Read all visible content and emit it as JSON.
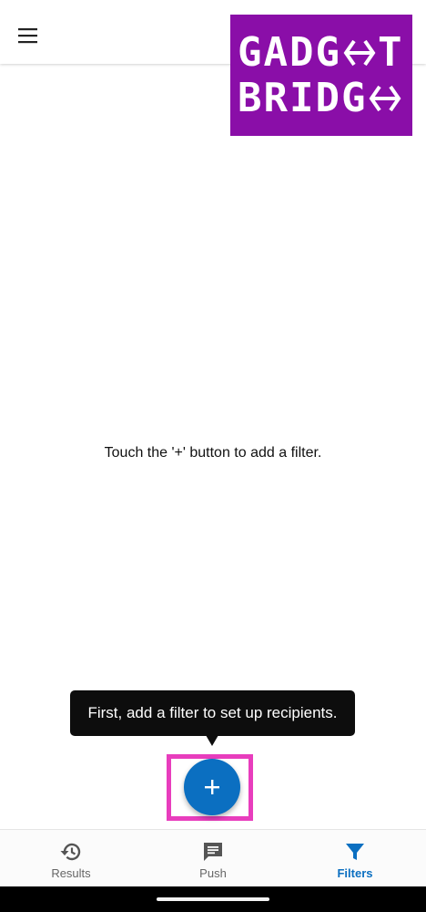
{
  "watermark": {
    "line1": "GADG",
    "line2": "BRIDG",
    "background": "#8a0ea8"
  },
  "header": {
    "menu_icon": "hamburger-menu-icon"
  },
  "main": {
    "empty_message": "Touch the '+' button to add a filter."
  },
  "tooltip": {
    "text": "First, add a filter to set up recipients."
  },
  "fab": {
    "icon": "plus-icon",
    "color": "#0b6fc1"
  },
  "highlight_color": "#e83dbd",
  "bottom_nav": {
    "items": [
      {
        "label": "Results",
        "icon": "history-icon",
        "active": false
      },
      {
        "label": "Push",
        "icon": "message-icon",
        "active": false
      },
      {
        "label": "Filters",
        "icon": "filter-icon",
        "active": true
      }
    ],
    "active_color": "#0b6fc1"
  }
}
